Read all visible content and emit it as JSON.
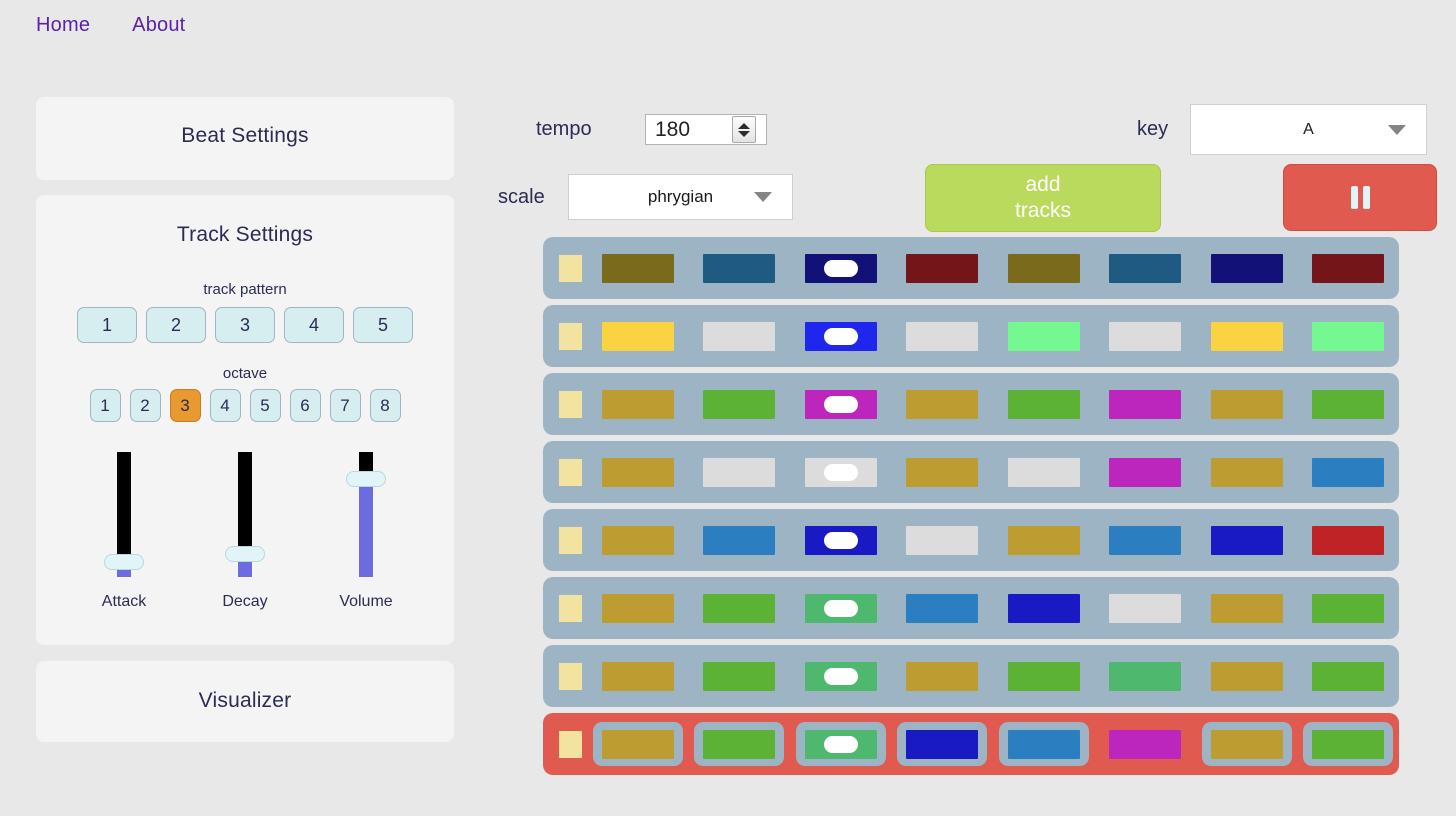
{
  "nav": {
    "items": [
      {
        "label": "Home"
      },
      {
        "label": "About"
      }
    ]
  },
  "panels": {
    "beat": {
      "title": "Beat Settings"
    },
    "track": {
      "title": "Track Settings"
    },
    "visualizer": {
      "title": "Visualizer"
    }
  },
  "track_settings": {
    "pattern_label": "track pattern",
    "pattern_buttons": [
      "1",
      "2",
      "3",
      "4",
      "5"
    ],
    "pattern_active": null,
    "octave_label": "octave",
    "octave_buttons": [
      "1",
      "2",
      "3",
      "4",
      "5",
      "6",
      "7",
      "8"
    ],
    "octave_active": "3",
    "sliders": [
      {
        "label": "Attack",
        "value_pct": 12
      },
      {
        "label": "Decay",
        "value_pct": 18
      },
      {
        "label": "Volume",
        "value_pct": 78
      }
    ]
  },
  "transport": {
    "tempo_label": "tempo",
    "tempo_value": "180",
    "scale_label": "scale",
    "scale_value": "phrygian",
    "key_label": "key",
    "key_value": "A",
    "add_tracks_label": "add\ntracks",
    "pause_icon": "pause-icon"
  },
  "colors": {
    "page_bg": "#e8e8e8",
    "panel_bg": "#f4f4f4",
    "nav_link": "#5b21a8",
    "heading": "#2b2b55",
    "track_bg": "#9db4c4",
    "track_playing_bg": "#e05a4f",
    "marker": "#f2e4a0",
    "add_tracks": "#bada5d",
    "pause": "#e05a4f",
    "octave_active": "#e8992f",
    "button_bg": "#d7eef0",
    "slider_fill": "#6c6ce0"
  },
  "sequencer": {
    "step_count": 8,
    "playing_row_index": 7,
    "tracks": [
      {
        "marker": true,
        "playing": false,
        "cells": [
          {
            "color": "#796a1c",
            "toggle": false
          },
          {
            "color": "#1f5a82",
            "toggle": false
          },
          {
            "color": "#121178",
            "toggle": true
          },
          {
            "color": "#741519",
            "toggle": false
          },
          {
            "color": "#796a1c",
            "toggle": false
          },
          {
            "color": "#1f5a82",
            "toggle": false
          },
          {
            "color": "#121178",
            "toggle": false
          },
          {
            "color": "#741519",
            "toggle": false
          }
        ]
      },
      {
        "marker": true,
        "playing": false,
        "cells": [
          {
            "color": "#f9d342",
            "toggle": false
          },
          {
            "color": "#dcdcdc",
            "toggle": false
          },
          {
            "color": "#1f26ee",
            "toggle": true
          },
          {
            "color": "#dcdcdc",
            "toggle": false
          },
          {
            "color": "#74f990",
            "toggle": false
          },
          {
            "color": "#dcdcdc",
            "toggle": false
          },
          {
            "color": "#f9d342",
            "toggle": false
          },
          {
            "color": "#74f990",
            "toggle": false
          }
        ]
      },
      {
        "marker": true,
        "playing": false,
        "cells": [
          {
            "color": "#bd9c31",
            "toggle": false
          },
          {
            "color": "#5cb234",
            "toggle": false
          },
          {
            "color": "#bc26bc",
            "toggle": true
          },
          {
            "color": "#bd9c31",
            "toggle": false
          },
          {
            "color": "#5cb234",
            "toggle": false
          },
          {
            "color": "#bc26bc",
            "toggle": false
          },
          {
            "color": "#bd9c31",
            "toggle": false
          },
          {
            "color": "#5cb234",
            "toggle": false
          }
        ]
      },
      {
        "marker": true,
        "playing": false,
        "cells": [
          {
            "color": "#bd9c31",
            "toggle": false
          },
          {
            "color": "#dcdcdc",
            "toggle": false
          },
          {
            "color": "#dcdcdc",
            "toggle": true
          },
          {
            "color": "#bd9c31",
            "toggle": false
          },
          {
            "color": "#dcdcdc",
            "toggle": false
          },
          {
            "color": "#bc26bc",
            "toggle": false
          },
          {
            "color": "#bd9c31",
            "toggle": false
          },
          {
            "color": "#2b7fc0",
            "toggle": false
          }
        ]
      },
      {
        "marker": true,
        "playing": false,
        "cells": [
          {
            "color": "#bd9c31",
            "toggle": false
          },
          {
            "color": "#2b7fc0",
            "toggle": false
          },
          {
            "color": "#1a1ac4",
            "toggle": true
          },
          {
            "color": "#dcdcdc",
            "toggle": false
          },
          {
            "color": "#bd9c31",
            "toggle": false
          },
          {
            "color": "#2b7fc0",
            "toggle": false
          },
          {
            "color": "#1a1ac4",
            "toggle": false
          },
          {
            "color": "#bf2326",
            "toggle": false
          }
        ]
      },
      {
        "marker": true,
        "playing": false,
        "cells": [
          {
            "color": "#bd9c31",
            "toggle": false
          },
          {
            "color": "#5cb234",
            "toggle": false
          },
          {
            "color": "#4eb86e",
            "toggle": true
          },
          {
            "color": "#2b7fc0",
            "toggle": false
          },
          {
            "color": "#1a1ac4",
            "toggle": false
          },
          {
            "color": "#dcdcdc",
            "toggle": false
          },
          {
            "color": "#bd9c31",
            "toggle": false
          },
          {
            "color": "#5cb234",
            "toggle": false
          }
        ]
      },
      {
        "marker": true,
        "playing": false,
        "cells": [
          {
            "color": "#bd9c31",
            "toggle": false
          },
          {
            "color": "#5cb234",
            "toggle": false
          },
          {
            "color": "#4eb86e",
            "toggle": true
          },
          {
            "color": "#bd9c31",
            "toggle": false
          },
          {
            "color": "#5cb234",
            "toggle": false
          },
          {
            "color": "#4eb86e",
            "toggle": false
          },
          {
            "color": "#bd9c31",
            "toggle": false
          },
          {
            "color": "#5cb234",
            "toggle": false
          }
        ]
      },
      {
        "marker": true,
        "playing": true,
        "cells": [
          {
            "color": "#bd9c31",
            "toggle": false,
            "framed": true
          },
          {
            "color": "#5cb234",
            "toggle": false,
            "framed": true
          },
          {
            "color": "#4eb86e",
            "toggle": true,
            "framed": true
          },
          {
            "color": "#1a1ac4",
            "toggle": false,
            "framed": true
          },
          {
            "color": "#2b7fc0",
            "toggle": false,
            "framed": true
          },
          {
            "color": "#bc26bc",
            "toggle": false,
            "framed": false
          },
          {
            "color": "#bd9c31",
            "toggle": false,
            "framed": true
          },
          {
            "color": "#5cb234",
            "toggle": false,
            "framed": true
          }
        ]
      }
    ]
  }
}
